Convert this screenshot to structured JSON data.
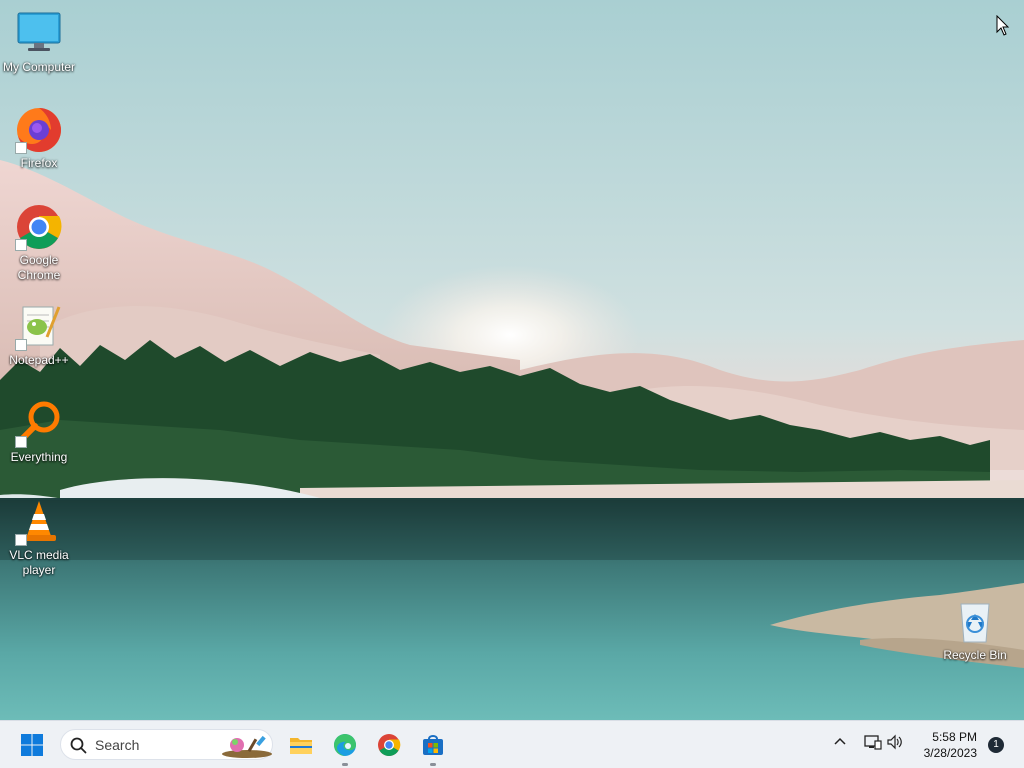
{
  "desktop": {
    "icons": [
      {
        "label": "My Computer",
        "icon": "computer-icon"
      },
      {
        "label": "Firefox",
        "icon": "firefox-icon"
      },
      {
        "label": "Google Chrome",
        "icon": "chrome-icon"
      },
      {
        "label": "Notepad++",
        "icon": "notepad-plus-plus-icon"
      },
      {
        "label": "Everything",
        "icon": "everything-search-icon"
      },
      {
        "label": "VLC media player",
        "icon": "vlc-icon"
      },
      {
        "label": "Recycle Bin",
        "icon": "recycle-bin-icon"
      }
    ]
  },
  "taskbar": {
    "search_label": "Search",
    "apps": [
      "file-explorer-icon",
      "edge-icon",
      "chrome-icon",
      "microsoft-store-icon"
    ],
    "clock": {
      "time": "5:58 PM",
      "date": "3/28/2023"
    },
    "notification_count": "1"
  },
  "colors": {
    "taskbar_bg": "#eef1f5",
    "accent": "#0078d4"
  }
}
